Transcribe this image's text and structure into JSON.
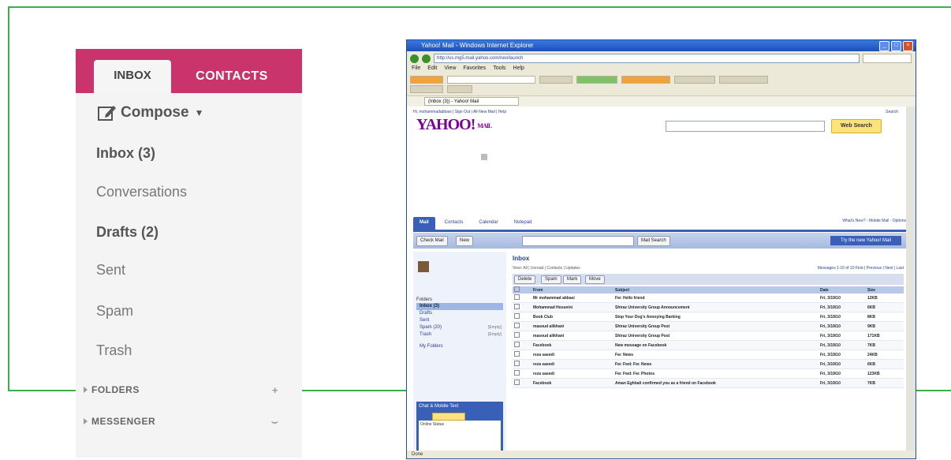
{
  "left_panel": {
    "tabs": {
      "inbox": "INBOX",
      "contacts": "CONTACTS"
    },
    "compose_label": "Compose",
    "folders": [
      {
        "label": "Inbox (3)",
        "bold": true
      },
      {
        "label": "Conversations",
        "bold": false
      },
      {
        "label": "Drafts (2)",
        "bold": true
      },
      {
        "label": "Sent",
        "bold": false
      },
      {
        "label": "Spam",
        "bold": false
      },
      {
        "label": "Trash",
        "bold": false
      }
    ],
    "sections": [
      {
        "label": "FOLDERS",
        "icon": "plus-icon",
        "glyph": "+"
      },
      {
        "label": "MESSENGER",
        "icon": "emoticon-icon",
        "glyph": "⌣"
      }
    ]
  },
  "browser": {
    "title": "Yahoo! Mail - Windows Internet Explorer",
    "address": "http://us.mg5.mail.yahoo.com/neo/launch",
    "menu": [
      "File",
      "Edit",
      "View",
      "Favorites",
      "Tools",
      "Help"
    ],
    "active_tab": "(Inbox (3)) - Yahoo! Mail",
    "status": "Done"
  },
  "yahoo": {
    "top_links": "Hi, mohammadabbasi  |  Sign Out  |  All-New Mail  |  Help",
    "top_links_right": "Search",
    "logo": "YAHOO!",
    "logo_sub": "MAIL",
    "search_button": "Web Search",
    "tabs": [
      "Mail",
      "Contacts",
      "Calendar",
      "Notepad"
    ],
    "tab_links": "What's New?  -  Mobile Mail  -  Options",
    "check_mail": "Check Mail",
    "new_label": "New",
    "mail_search": "Mail Search",
    "new_yahoo": "Try the new Yahoo! Mail",
    "folders_title": "Folders",
    "folder_items": [
      {
        "label": "Inbox (3)",
        "selected": true,
        "side": ""
      },
      {
        "label": "Drafts",
        "selected": false,
        "side": ""
      },
      {
        "label": "Sent",
        "selected": false,
        "side": ""
      },
      {
        "label": "Spam (20)",
        "selected": false,
        "side": "[Empty]"
      },
      {
        "label": "Trash",
        "selected": false,
        "side": "[Empty]"
      }
    ],
    "my_folders": "My Folders",
    "chat_header": "Chat & Mobile Text",
    "chat_body": "Online Status",
    "inbox_title": "Inbox",
    "inbox_meta_left": "View: All  |  Unread  |  Contacts  |  Updates",
    "inbox_meta_right": "Messages 1-10 of 10  First | Previous | Next | Last",
    "toolbar_buttons": [
      "Delete",
      "Spam",
      "Mark",
      "Move"
    ],
    "columns": [
      "",
      "From",
      "Subject",
      "Date",
      "Size"
    ],
    "messages": [
      {
        "from": "Mr mohammad abbasi",
        "subject": "Fw: Hello friend",
        "date": "Fri, 3/19/10",
        "size": "12KB"
      },
      {
        "from": "Mohammad Hosseini",
        "subject": "Shiraz University Group Announcement",
        "date": "Fri, 3/19/10",
        "size": "6KB"
      },
      {
        "from": "Book Club",
        "subject": "Stop Your Dog's Annoying Barking",
        "date": "Fri, 3/19/10",
        "size": "8KB"
      },
      {
        "from": "masoud alikhani",
        "subject": "Shiraz University Group Post",
        "date": "Fri, 3/19/10",
        "size": "9KB"
      },
      {
        "from": "masoud alikhani",
        "subject": "Shiraz University Group Post",
        "date": "Fri, 3/19/10",
        "size": "171KB"
      },
      {
        "from": "Facebook",
        "subject": "New message on Facebook",
        "date": "Fri, 3/19/10",
        "size": "7KB"
      },
      {
        "from": "reza saeedi",
        "subject": "Fw: News",
        "date": "Fri, 3/19/10",
        "size": "24KB"
      },
      {
        "from": "reza saeedi",
        "subject": "Fw: Fwd: Fw: News",
        "date": "Fri, 3/19/10",
        "size": "6KB"
      },
      {
        "from": "reza saeedi",
        "subject": "Fw: Fwd: Fw: Photos",
        "date": "Fri, 3/19/10",
        "size": "123KB"
      },
      {
        "from": "Facebook",
        "subject": "Aman Eghbali confirmed you as a friend on Facebook",
        "date": "Fri, 3/19/10",
        "size": "7KB"
      }
    ]
  }
}
